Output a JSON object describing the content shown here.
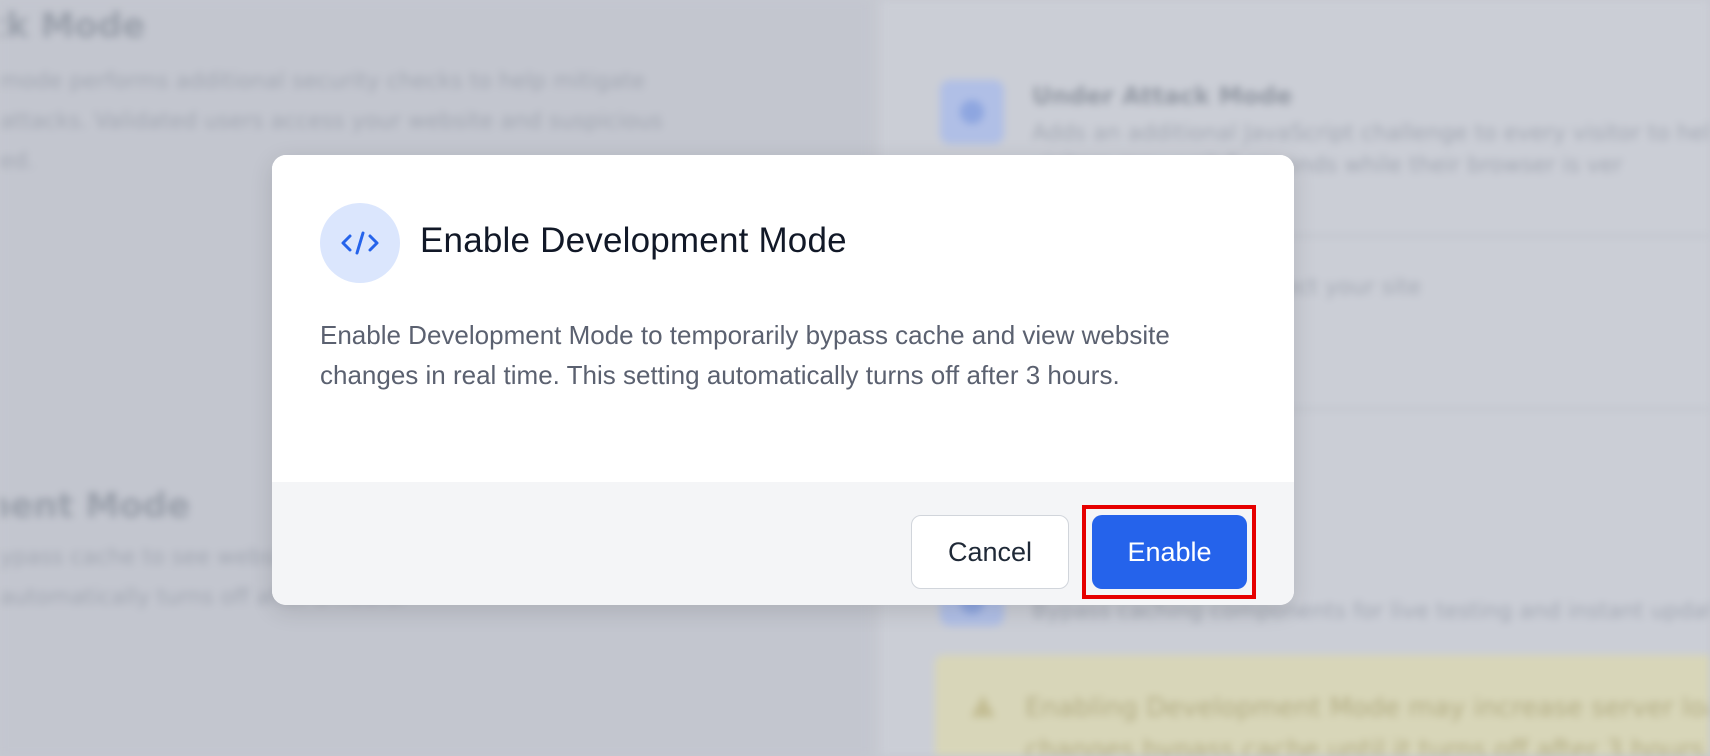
{
  "background": {
    "left_heading_1": "ck Mode",
    "left_text_1": [
      "mode performs additional security checks to help mitigate",
      "attacks. Validated users access your website and suspicious",
      "ed."
    ],
    "left_heading_2": "nent Mode",
    "left_text_2": [
      "ypass cache to see website changes in real time",
      "automatically turns off after 3 hours."
    ],
    "right_card_title": "Under Attack Mode",
    "right_card_text": [
      "Adds an additional JavaScript challenge to every visitor to hel",
      "visitors may wait 5 seconds while their browser is ver"
    ],
    "right_text_2": "for visitors to help protect your site",
    "right_text_3": "Bypass caching components for live testing and instant updates",
    "warning_text": [
      "Enabling Development Mode may increase server load",
      "changes bypass cache until it turns off after 3 hours"
    ]
  },
  "modal": {
    "icon": "code-icon",
    "icon_color": "#2563eb",
    "icon_bg_color": "#dbe6fd",
    "title": "Enable Development Mode",
    "description": "Enable Development Mode to temporarily bypass cache and view website changes in real time. This setting automatically turns off after 3 hours.",
    "cancel_label": "Cancel",
    "enable_label": "Enable",
    "primary_color": "#2563eb",
    "highlight_color": "#e60000"
  }
}
